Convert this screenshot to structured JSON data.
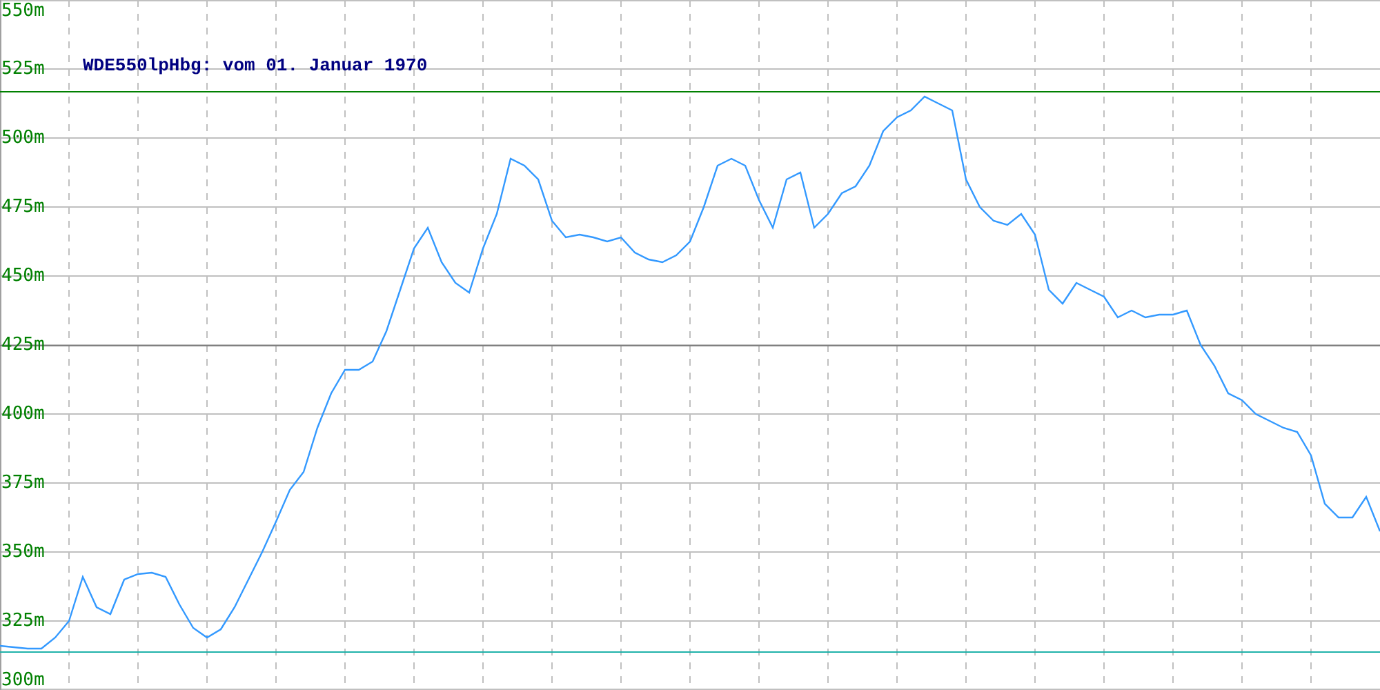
{
  "chart": {
    "chart_data": {
      "type": "line",
      "title": "WDE550lpHbg: vom 01. Januar 1970",
      "ylim": [
        300,
        550
      ],
      "yticks": [
        {
          "value": 300,
          "label": "300m"
        },
        {
          "value": 325,
          "label": "325m"
        },
        {
          "value": 350,
          "label": "350m"
        },
        {
          "value": 375,
          "label": "375m"
        },
        {
          "value": 400,
          "label": "400m"
        },
        {
          "value": 425,
          "label": "425m"
        },
        {
          "value": 450,
          "label": "450m"
        },
        {
          "value": 475,
          "label": "475m"
        },
        {
          "value": 500,
          "label": "500m"
        },
        {
          "value": 525,
          "label": "525m"
        },
        {
          "value": 550,
          "label": "550m"
        }
      ],
      "categories": [
        null,
        null,
        null,
        null,
        null,
        null,
        null,
        null,
        null,
        null,
        null,
        null,
        null,
        null,
        null,
        null,
        null,
        null,
        null,
        null,
        null,
        null,
        null,
        null,
        null,
        null,
        null,
        null,
        null,
        null,
        null,
        null,
        null,
        null,
        null,
        null,
        null,
        null,
        null,
        null,
        null,
        null,
        null,
        null,
        null,
        null,
        null,
        null,
        null,
        null,
        null,
        null,
        null,
        null,
        null,
        null,
        null,
        null,
        null,
        null,
        null,
        null,
        null,
        null,
        null,
        null,
        null,
        null,
        null,
        null,
        null,
        null,
        null,
        null,
        null,
        null,
        null,
        null,
        null,
        null,
        null,
        null,
        null,
        null,
        null,
        null,
        null,
        null,
        null,
        null,
        null,
        null,
        null,
        null,
        null,
        null,
        null,
        null,
        null,
        null,
        null
      ],
      "series": [
        {
          "color": "#3399ff",
          "values": [
            316,
            315.5,
            315,
            315,
            319,
            325,
            341,
            330,
            327.5,
            340,
            342,
            342.5,
            341,
            331,
            322.5,
            319,
            322,
            330,
            340,
            350,
            361,
            372.5,
            379,
            395,
            407.5,
            416,
            416,
            419,
            430,
            445,
            460,
            467.5,
            455,
            447.5,
            444,
            460,
            472.5,
            492.5,
            490,
            485,
            470,
            464,
            465,
            464,
            462.5,
            464,
            458.5,
            456,
            455,
            457.5,
            462.5,
            475,
            490,
            492.5,
            490,
            477.5,
            467.5,
            485,
            487.5,
            467.5,
            472.5,
            480,
            482.5,
            490,
            502.5,
            507.5,
            510,
            515,
            512.5,
            510,
            485,
            475,
            470,
            468.5,
            472.5,
            465,
            445,
            440,
            447.5,
            445,
            442.5,
            435,
            437.5,
            435,
            436,
            436,
            437.5,
            425,
            417.5,
            407.5,
            405,
            400,
            397.5,
            395,
            393.5,
            385,
            367.5,
            362.5,
            362.5,
            370,
            357.5
          ]
        }
      ],
      "grid": true,
      "ref_lines": [
        {
          "axis": "y",
          "value": 517,
          "color": "#008000"
        },
        {
          "axis": "y",
          "value": 425,
          "color": "#808080"
        },
        {
          "axis": "y",
          "value": 314,
          "color": "#20b2aa"
        }
      ]
    }
  }
}
